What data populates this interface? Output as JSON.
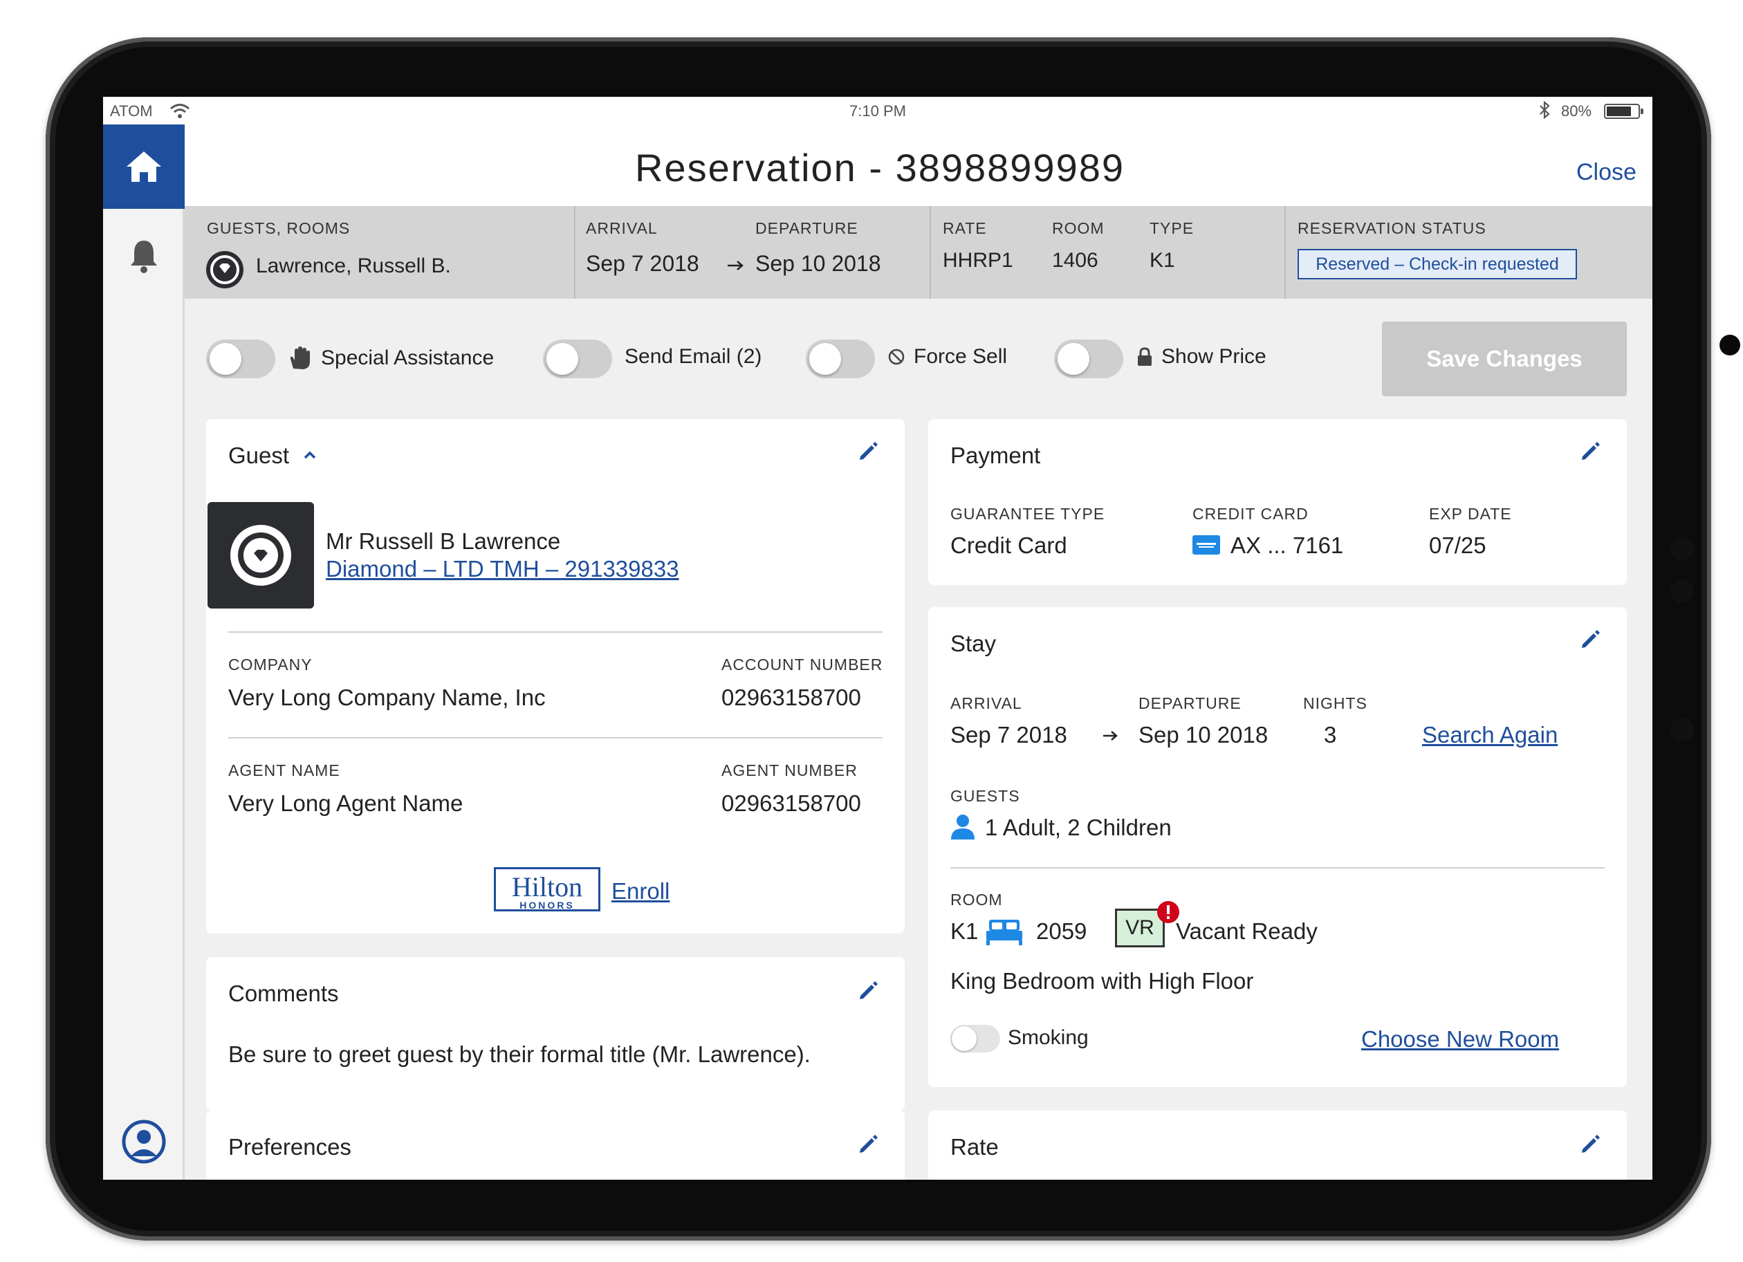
{
  "status_bar": {
    "carrier": "ATOM",
    "time": "7:10 PM",
    "battery": "80%",
    "battery_level": 0.8
  },
  "header": {
    "title": "Reservation - 3898899989",
    "close_label": "Close"
  },
  "summary": {
    "guests_rooms_label": "GUESTS, ROOMS",
    "guest_name": "Lawrence, Russell B.",
    "arrival_label": "ARRIVAL",
    "arrival": "Sep 7 2018",
    "departure_label": "DEPARTURE",
    "departure": "Sep 10 2018",
    "rate_label": "RATE",
    "rate": "HHRP1",
    "room_label": "ROOM",
    "room": "1406",
    "type_label": "TYPE",
    "type": "K1",
    "status_label": "RESERVATION STATUS",
    "status": "Reserved – Check-in requested"
  },
  "toggles": {
    "special_assistance": {
      "label": "Special Assistance",
      "on": false
    },
    "send_email": {
      "label": "Send Email (2)",
      "on": false
    },
    "force_sell": {
      "label": "Force Sell",
      "on": false
    },
    "show_price": {
      "label": "Show Price",
      "on": false
    }
  },
  "save_label": "Save Changes",
  "guest_card": {
    "title": "Guest",
    "full_name": "Mr Russell B Lawrence",
    "tier_link": "Diamond – LTD TMH – 291339833",
    "company_label": "COMPANY",
    "company": "Very Long Company Name, Inc",
    "account_label": "ACCOUNT NUMBER",
    "account": "02963158700",
    "agent_name_label": "AGENT NAME",
    "agent_name": "Very Long Agent Name",
    "agent_number_label": "AGENT NUMBER",
    "agent_number": "02963158700",
    "brand_name": "Hilton",
    "brand_sub": "HONORS",
    "enroll_label": "Enroll"
  },
  "comments_card": {
    "title": "Comments",
    "text": "Be sure to greet guest by their formal title (Mr. Lawrence)."
  },
  "preferences_card": {
    "title": "Preferences"
  },
  "payment_card": {
    "title": "Payment",
    "guarantee_label": "GUARANTEE TYPE",
    "guarantee": "Credit Card",
    "card_label": "CREDIT CARD",
    "card": "AX ... 7161",
    "exp_label": "EXP DATE",
    "exp": "07/25"
  },
  "stay_card": {
    "title": "Stay",
    "arrival_label": "ARRIVAL",
    "arrival": "Sep 7 2018",
    "departure_label": "DEPARTURE",
    "departure": "Sep 10 2018",
    "nights_label": "NIGHTS",
    "nights": "3",
    "search_again": "Search Again",
    "guests_label": "GUESTS",
    "guests": "1 Adult, 2 Children",
    "room_label": "ROOM",
    "room_type": "K1",
    "room_number": "2059",
    "room_status_code": "VR",
    "room_status": "Vacant Ready",
    "room_desc": "King Bedroom with High Floor",
    "smoking_label": "Smoking",
    "choose_room": "Choose New Room"
  },
  "rate_card": {
    "title": "Rate"
  },
  "colors": {
    "brand": "#1f4e9c",
    "accent": "#1e88e5",
    "alert": "#d0021b",
    "vr_badge": "#d6efd9",
    "save_disabled": "#c9c9c9"
  },
  "icons": [
    "home-icon",
    "bell-icon",
    "profile-icon",
    "wifi-icon",
    "bluetooth-icon",
    "diamond-icon",
    "hand-icon",
    "no-entry-icon",
    "lock-icon",
    "pencil-icon",
    "chevron-up-icon",
    "amex-card-icon",
    "arrow-right-icon",
    "person-icon",
    "bed-icon",
    "alert-icon"
  ]
}
